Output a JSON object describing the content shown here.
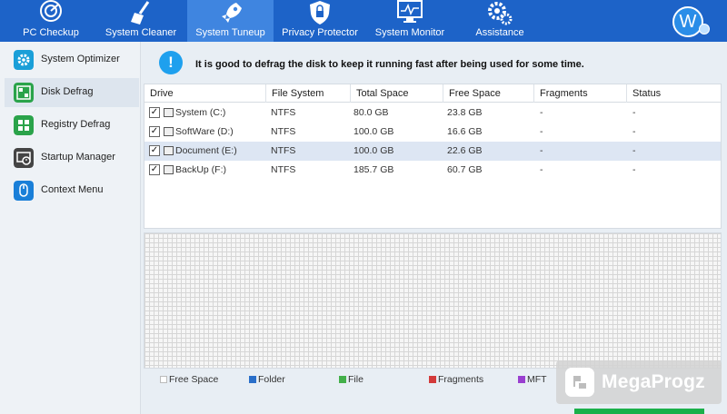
{
  "nav": {
    "tabs": [
      {
        "label": "PC Checkup",
        "icon": "radar-icon"
      },
      {
        "label": "System Cleaner",
        "icon": "broom-icon"
      },
      {
        "label": "System Tuneup",
        "icon": "rocket-icon",
        "active": true
      },
      {
        "label": "Privacy Protector",
        "icon": "shield-icon"
      },
      {
        "label": "System Monitor",
        "icon": "monitor-icon"
      },
      {
        "label": "Assistance",
        "icon": "gears-icon"
      }
    ],
    "avatar_letter": "W"
  },
  "sidebar": {
    "items": [
      {
        "label": "System Optimizer",
        "icon": "optimizer-icon",
        "color": "#1a9fd8"
      },
      {
        "label": "Disk Defrag",
        "icon": "disk-defrag-icon",
        "color": "#2aa34a",
        "active": true
      },
      {
        "label": "Registry Defrag",
        "icon": "registry-defrag-icon",
        "color": "#2aa34a"
      },
      {
        "label": "Startup Manager",
        "icon": "startup-manager-icon",
        "color": "#444444"
      },
      {
        "label": "Context Menu",
        "icon": "context-menu-icon",
        "color": "#1a7fd8"
      }
    ]
  },
  "banner": {
    "icon": "info-icon",
    "text": "It is good to defrag the disk to keep it running fast after being used for some time."
  },
  "drives": {
    "columns": [
      "Drive",
      "File System",
      "Total Space",
      "Free Space",
      "Fragments",
      "Status"
    ],
    "rows": [
      {
        "checked": true,
        "drive": "System (C:)",
        "fs": "NTFS",
        "total": "80.0 GB",
        "free": "23.8 GB",
        "fragments": "-",
        "status": "-"
      },
      {
        "checked": true,
        "drive": "SoftWare (D:)",
        "fs": "NTFS",
        "total": "100.0 GB",
        "free": "16.6 GB",
        "fragments": "-",
        "status": "-"
      },
      {
        "checked": true,
        "drive": "Document (E:)",
        "fs": "NTFS",
        "total": "100.0 GB",
        "free": "22.6 GB",
        "fragments": "-",
        "status": "-",
        "selected": true
      },
      {
        "checked": true,
        "drive": "BackUp (F:)",
        "fs": "NTFS",
        "total": "185.7 GB",
        "free": "60.7 GB",
        "fragments": "-",
        "status": "-"
      }
    ]
  },
  "legend": [
    {
      "label": "Free Space",
      "color": "#ffffff"
    },
    {
      "label": "Folder",
      "color": "#2a6fc9"
    },
    {
      "label": "File",
      "color": "#43b04a"
    },
    {
      "label": "Fragments",
      "color": "#d33a3a"
    },
    {
      "label": "MFT",
      "color": "#9a3fd0"
    }
  ],
  "watermark": {
    "text": "MegaProgz"
  },
  "colors": {
    "nav": "#1d63c8",
    "nav_active": "#3f85e0",
    "accent_green": "#1bb04a"
  }
}
